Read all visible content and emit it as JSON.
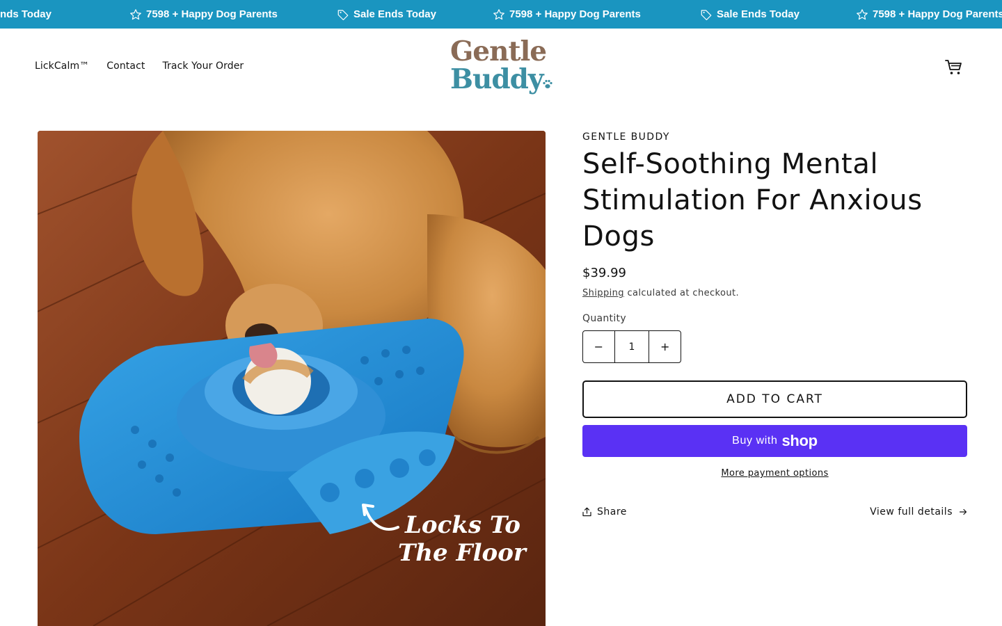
{
  "announcement": {
    "items": [
      {
        "icon": "tag-icon",
        "text": "Sale Ends Today"
      },
      {
        "icon": "star-icon",
        "text": "7598 + Happy Dog Parents"
      },
      {
        "icon": "tag-icon",
        "text": "Sale Ends Today"
      },
      {
        "icon": "star-icon",
        "text": "7598 + Happy Dog Parents"
      },
      {
        "icon": "tag-icon",
        "text": "Sale Ends Today"
      },
      {
        "icon": "star-icon",
        "text": "7598 + Happy Dog Parents"
      }
    ],
    "background": "#1a95c0"
  },
  "header": {
    "nav": [
      "LickCalm™",
      "Contact",
      "Track Your Order"
    ],
    "logo": {
      "line1": "Gentle",
      "line2": "Buddy"
    },
    "cart_icon": "cart-icon"
  },
  "product": {
    "image_overlay": {
      "line1": "Locks To",
      "line2": "The Floor"
    },
    "vendor": "GENTLE BUDDY",
    "title": "Self-Soothing Mental Stimulation For Anxious Dogs",
    "price": "$39.99",
    "shipping_link": "Shipping",
    "shipping_text": " calculated at checkout.",
    "quantity_label": "Quantity",
    "quantity_value": "1",
    "minus": "−",
    "plus": "+",
    "add_to_cart": "ADD TO CART",
    "buy_with": "Buy with",
    "shop_wordmark": "shop",
    "more_payment": "More payment options",
    "share": "Share",
    "view_full": "View full details"
  },
  "colors": {
    "accent": "#1a95c0",
    "shop_pay": "#5a31f4",
    "text": "#121212",
    "logo_brown": "#8a6b56",
    "logo_teal": "#3d8fa3"
  }
}
